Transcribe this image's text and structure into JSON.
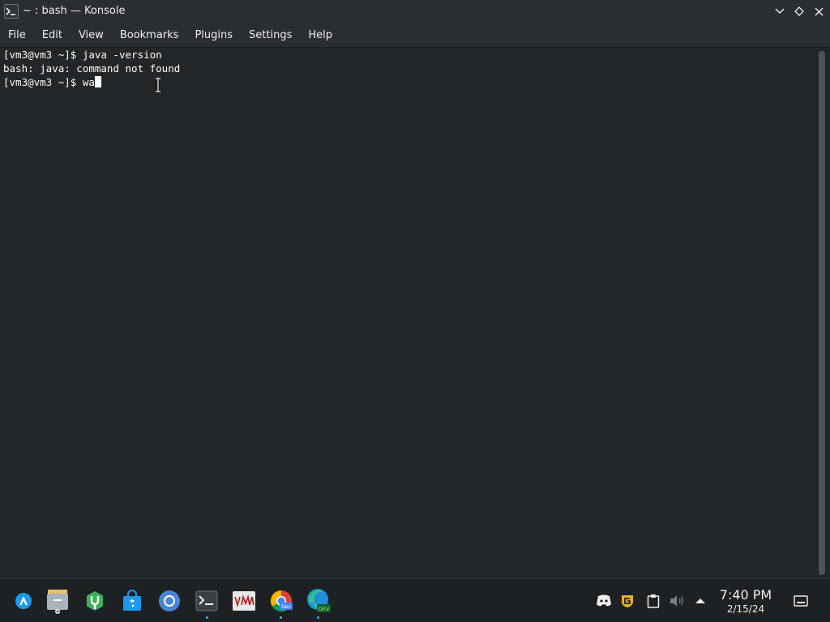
{
  "window": {
    "title": "~ : bash — Konsole"
  },
  "menu": {
    "items": [
      "File",
      "Edit",
      "View",
      "Bookmarks",
      "Plugins",
      "Settings",
      "Help"
    ]
  },
  "terminal": {
    "lines": [
      "[vm3@vm3 ~]$ java -version",
      "bash: java: command not found",
      "[vm3@vm3 ~]$ wa"
    ]
  },
  "taskbar": {
    "apps": [
      {
        "name": "application-launcher-icon"
      },
      {
        "name": "file-manager-icon"
      },
      {
        "name": "system-settings-icon"
      },
      {
        "name": "discover-store-icon"
      },
      {
        "name": "chromium-icon"
      },
      {
        "name": "konsole-icon",
        "active": true
      },
      {
        "name": "vnc-viewer-icon"
      },
      {
        "name": "chrome-dev-icon",
        "running": true
      },
      {
        "name": "edge-dev-icon",
        "running": true
      }
    ],
    "tray": {
      "icons": [
        "discord-icon",
        "guard-shield-icon",
        "clipboard-icon",
        "volume-icon",
        "expand-tray-icon"
      ]
    },
    "clock": {
      "time": "7:40 PM",
      "date": "2/15/24"
    }
  },
  "colors": {
    "accent": "#3daee9",
    "terminal_bg": "#232629",
    "titlebar_bg": "#2a2e32"
  }
}
